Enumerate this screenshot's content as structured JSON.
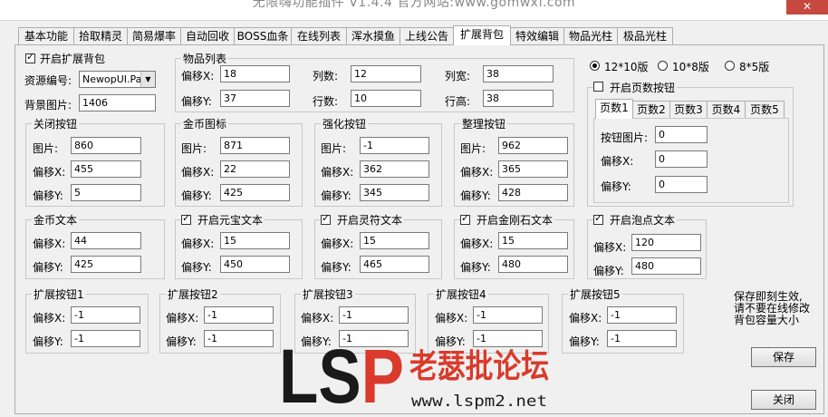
{
  "window": {
    "title": "无限嗨功能插件 V1.4.4  官方网站:www.gomwxf.com",
    "close_symbol": "✕"
  },
  "tabs": [
    "基本功能",
    "拾取精灵",
    "简易爆率",
    "自动回收",
    "BOSS血条",
    "在线列表",
    "浑水摸鱼",
    "上线公告",
    "扩展背包",
    "特效编辑",
    "物品光柱",
    "极品光柱"
  ],
  "active_tab": "扩展背包",
  "left": {
    "enable_label": "开启扩展背包",
    "enable_checked": true,
    "res_label": "资源编号:",
    "res_value": "NewopUI.Pal",
    "bg_label": "背景图片:",
    "bg_value": "1406"
  },
  "items": {
    "title": "物品列表",
    "offx_label": "偏移X:",
    "offx": "18",
    "offy_label": "偏移Y:",
    "offy": "37",
    "cols_label": "列数:",
    "cols": "12",
    "rows_label": "行数:",
    "rows": "10",
    "colw_label": "列宽:",
    "colw": "38",
    "rowh_label": "行高:",
    "rowh": "38"
  },
  "close_btn": {
    "title": "关闭按钮",
    "img_label": "图片:",
    "img": "860",
    "x_label": "偏移X:",
    "x": "455",
    "y_label": "偏移Y:",
    "y": "5"
  },
  "gold_icon": {
    "title": "金币图标",
    "img_label": "图片:",
    "img": "871",
    "x_label": "偏移X:",
    "x": "22",
    "y_label": "偏移Y:",
    "y": "425"
  },
  "strength_btn": {
    "title": "强化按钮",
    "img_label": "图片:",
    "img": "-1",
    "x_label": "偏移X:",
    "x": "362",
    "y_label": "偏移Y:",
    "y": "345"
  },
  "sort_btn": {
    "title": "整理按钮",
    "img_label": "图片:",
    "img": "962",
    "x_label": "偏移X:",
    "x": "365",
    "y_label": "偏移Y:",
    "y": "428"
  },
  "gold_text": {
    "title": "金币文本",
    "x_label": "偏移X:",
    "x": "44",
    "y_label": "偏移Y:",
    "y": "425"
  },
  "yuanbao_text": {
    "title": "开启元宝文本",
    "checked": true,
    "x_label": "偏移X:",
    "x": "15",
    "y_label": "偏移Y:",
    "y": "450"
  },
  "lingfu_text": {
    "title": "开启灵符文本",
    "checked": true,
    "x_label": "偏移X:",
    "x": "15",
    "y_label": "偏移Y:",
    "y": "465"
  },
  "diamond_text": {
    "title": "开启金刚石文本",
    "checked": true,
    "x_label": "偏移X:",
    "x": "15",
    "y_label": "偏移Y:",
    "y": "480"
  },
  "bubble_text": {
    "title": "开启泡点文本",
    "checked": true,
    "x_label": "偏移X:",
    "x": "120",
    "y_label": "偏移Y:",
    "y": "480"
  },
  "layout_options": [
    {
      "label": "12*10版",
      "selected": true
    },
    {
      "label": "10*8版",
      "selected": false
    },
    {
      "label": "8*5版",
      "selected": false
    }
  ],
  "pages": {
    "title": "开启页数按钮",
    "checked": false,
    "tabs": [
      "页数1",
      "页数2",
      "页数3",
      "页数4",
      "页数5"
    ],
    "active": "页数1",
    "img_label": "按钮图片:",
    "img": "0",
    "x_label": "偏移X:",
    "x": "0",
    "y_label": "偏移Y:",
    "y": "0"
  },
  "ext_buttons": [
    {
      "title": "扩展按钮1",
      "x_label": "偏移X:",
      "x": "-1",
      "y_label": "偏移Y:",
      "y": "-1"
    },
    {
      "title": "扩展按钮2",
      "x_label": "偏移X:",
      "x": "-1",
      "y_label": "偏移Y:",
      "y": "-1"
    },
    {
      "title": "扩展按钮3",
      "x_label": "偏移X:",
      "x": "-1",
      "y_label": "偏移Y:",
      "y": "-1"
    },
    {
      "title": "扩展按钮4",
      "x_label": "偏移X:",
      "x": "-1",
      "y_label": "偏移Y:",
      "y": "-1"
    },
    {
      "title": "扩展按钮5",
      "x_label": "偏移X:",
      "x": "-1",
      "y_label": "偏移Y:",
      "y": "-1"
    }
  ],
  "note": "保存即刻生效,\n请不要在线修改\n背包容量大小",
  "save_label": "保存",
  "close_label": "关闭",
  "watermark": {
    "logo": "LSP",
    "name": "老瑟批论坛",
    "url": "www.lspm2.net",
    "logo_color": "#d93a2b",
    "dark_color": "#1a1a1a"
  }
}
